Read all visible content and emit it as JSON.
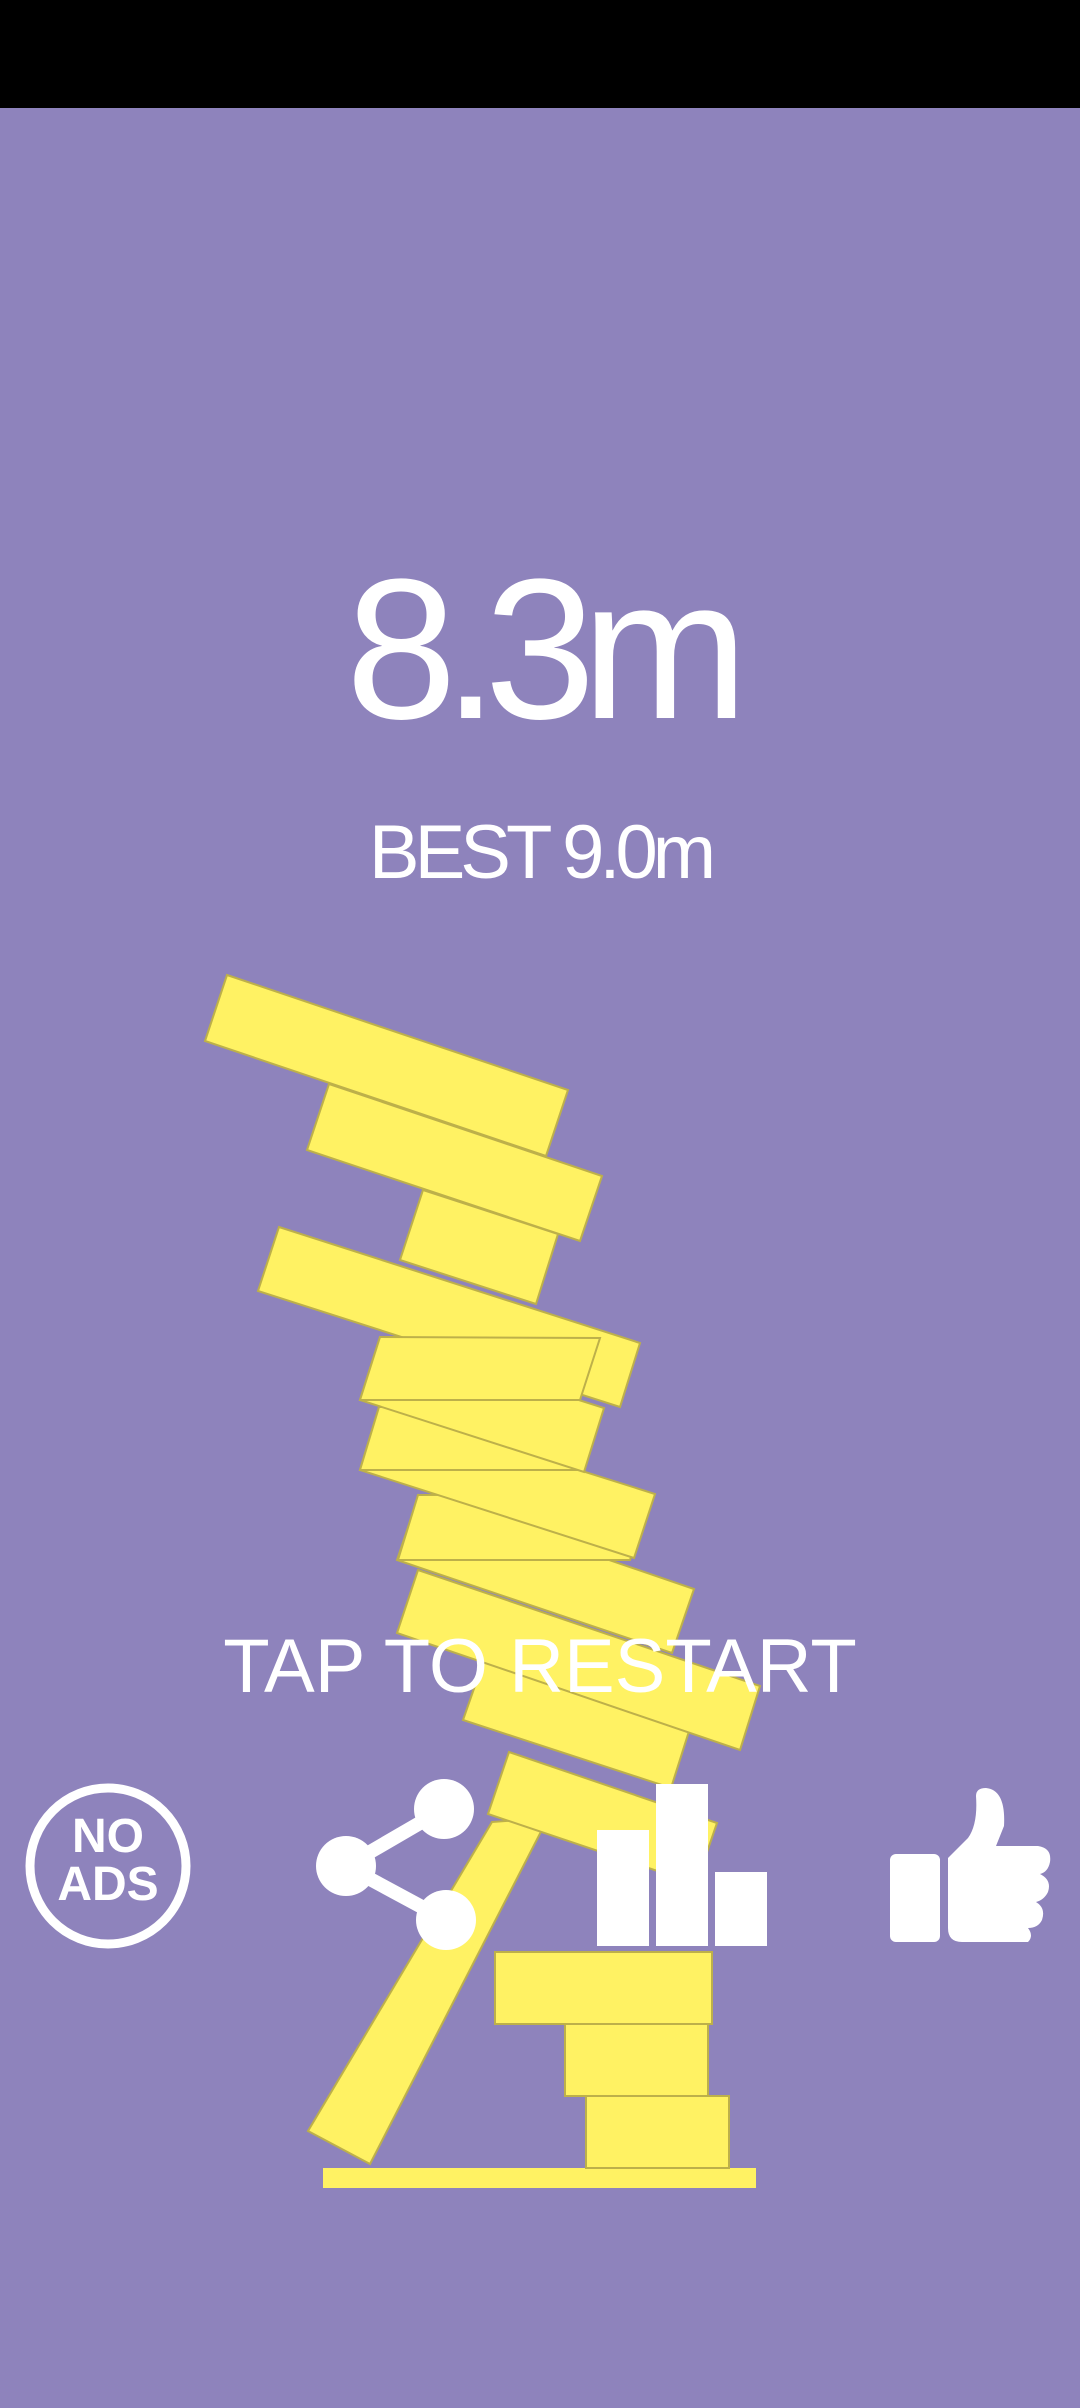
{
  "game": {
    "score": "8.3m",
    "best": "BEST 9.0m",
    "restart_prompt": "TAP TO RESTART"
  },
  "buttons": {
    "no_ads_line1": "NO",
    "no_ads_line2": "ADS",
    "share_icon": "share-icon",
    "leaderboard_icon": "bar-chart-icon",
    "like_icon": "thumbs-up-icon"
  },
  "colors": {
    "background": "#8e83bc",
    "block": "#fff263",
    "text": "#ffffff",
    "status_bar": "#000000"
  }
}
